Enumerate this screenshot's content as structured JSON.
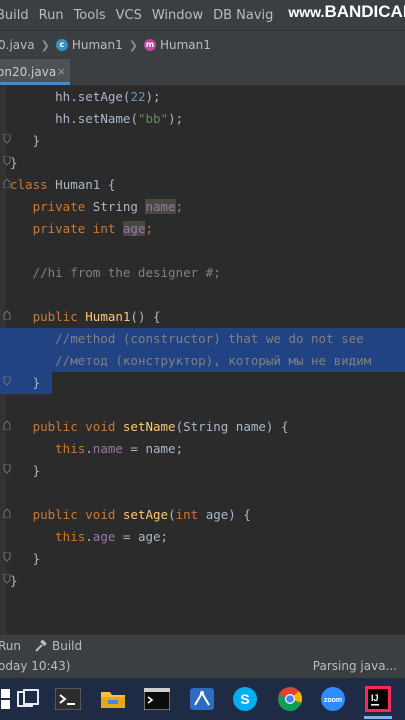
{
  "menubar": {
    "items": [
      "Build",
      "Run",
      "Tools",
      "VCS",
      "Window",
      "DB Navig"
    ],
    "watermark_www": "www.",
    "watermark_brand": "BANDICAM"
  },
  "breadcrumbs": {
    "file": "0.java",
    "class_name": "Human1",
    "method_name": "Human1",
    "class_icon_letter": "c",
    "method_icon_letter": "m"
  },
  "tab": {
    "label": "on20.java",
    "close": "×"
  },
  "code": {
    "line1": {
      "obj": "hh",
      "method": "setAge",
      "arg": "22"
    },
    "line2": {
      "obj": "hh",
      "method": "setName",
      "arg": "\"bb\""
    },
    "class_decl": {
      "keyword": "class",
      "name": "Human1 {"
    },
    "field1": {
      "mod": "private",
      "type": "String",
      "name": "name"
    },
    "field2": {
      "mod": "private",
      "type": "int",
      "name": "age"
    },
    "comment1": "//hi from the designer #;",
    "ctor": {
      "mod": "public",
      "name": "Human1",
      "rest": "() {"
    },
    "comment2": "//method (constructor) that we do not see",
    "comment3": "//метод (конструктор), который мы не видим",
    "setname_decl": {
      "mod": "public",
      "type": "void",
      "name": "setName",
      "params": "(String name) {"
    },
    "setname_body": {
      "this": "this",
      "field": "name",
      "rhs": " = name;"
    },
    "setage_decl": {
      "mod": "public",
      "type": "void",
      "name": "setAge",
      "param_type": "int",
      "params_end": " age) {"
    },
    "setage_body": {
      "this": "this",
      "field": "age",
      "rhs": " = age;"
    }
  },
  "statusbar": {
    "run_label": "Run",
    "build_label": "Build",
    "status_left": "oday 10:43)",
    "status_right": "Parsing java..."
  },
  "taskbar": {
    "icons": [
      "windows-start-icon",
      "task-view-icon",
      "terminal-icon",
      "file-explorer-icon",
      "console-icon",
      "network-icon",
      "skype-icon",
      "chrome-icon",
      "zoom-icon",
      "intellij-icon"
    ],
    "zoom_text": "zoom",
    "intellij_text": "IJ",
    "skype_text": "S"
  }
}
